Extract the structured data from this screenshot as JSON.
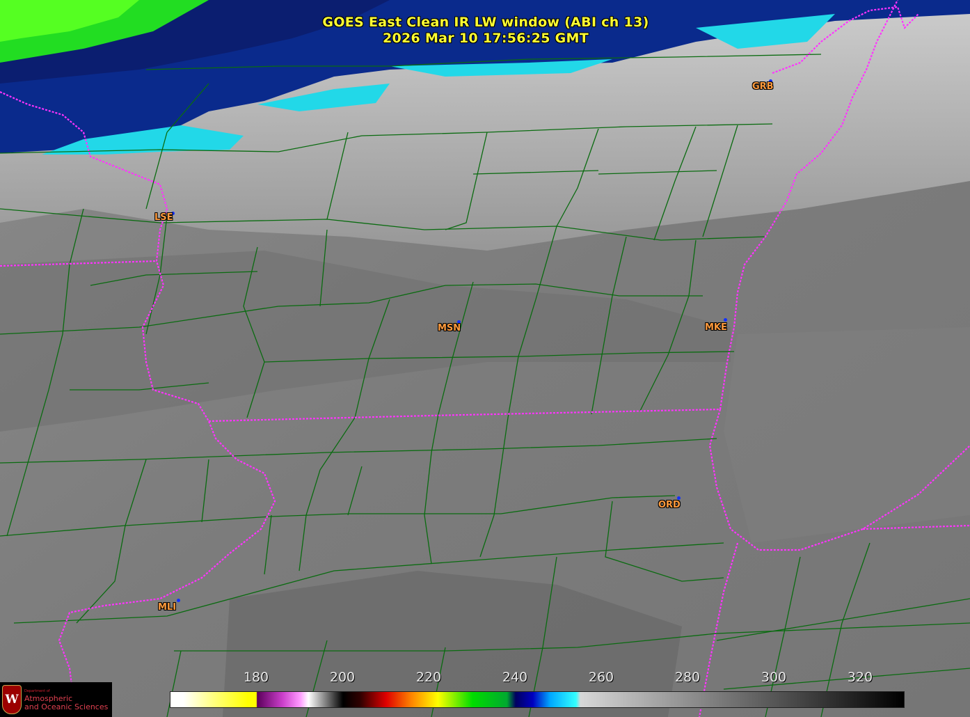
{
  "title": {
    "line1": "GOES East Clean IR LW window (ABI ch 13)",
    "line2": "2026 Mar 10  17:56:25 GMT"
  },
  "stations": [
    {
      "code": "LSE"
    },
    {
      "code": "MSN"
    },
    {
      "code": "MKE"
    },
    {
      "code": "GRB"
    },
    {
      "code": "ORD"
    },
    {
      "code": "MLI"
    }
  ],
  "colorbar": {
    "unit_range": [
      160,
      330
    ],
    "ticks": [
      "180",
      "200",
      "220",
      "240",
      "260",
      "280",
      "300",
      "320"
    ],
    "tick_values": [
      180,
      200,
      220,
      240,
      260,
      280,
      300,
      320
    ]
  },
  "logo": {
    "letter": "W",
    "department": "Department of",
    "line1": "Atmospheric",
    "line2": "and Oceanic Sciences"
  },
  "colors": {
    "title": "#ffff33",
    "station_label": "#ff9a3c",
    "station_dot": "#1030ff",
    "county_border": "#0a6b10",
    "state_border": "#ff33ff"
  }
}
